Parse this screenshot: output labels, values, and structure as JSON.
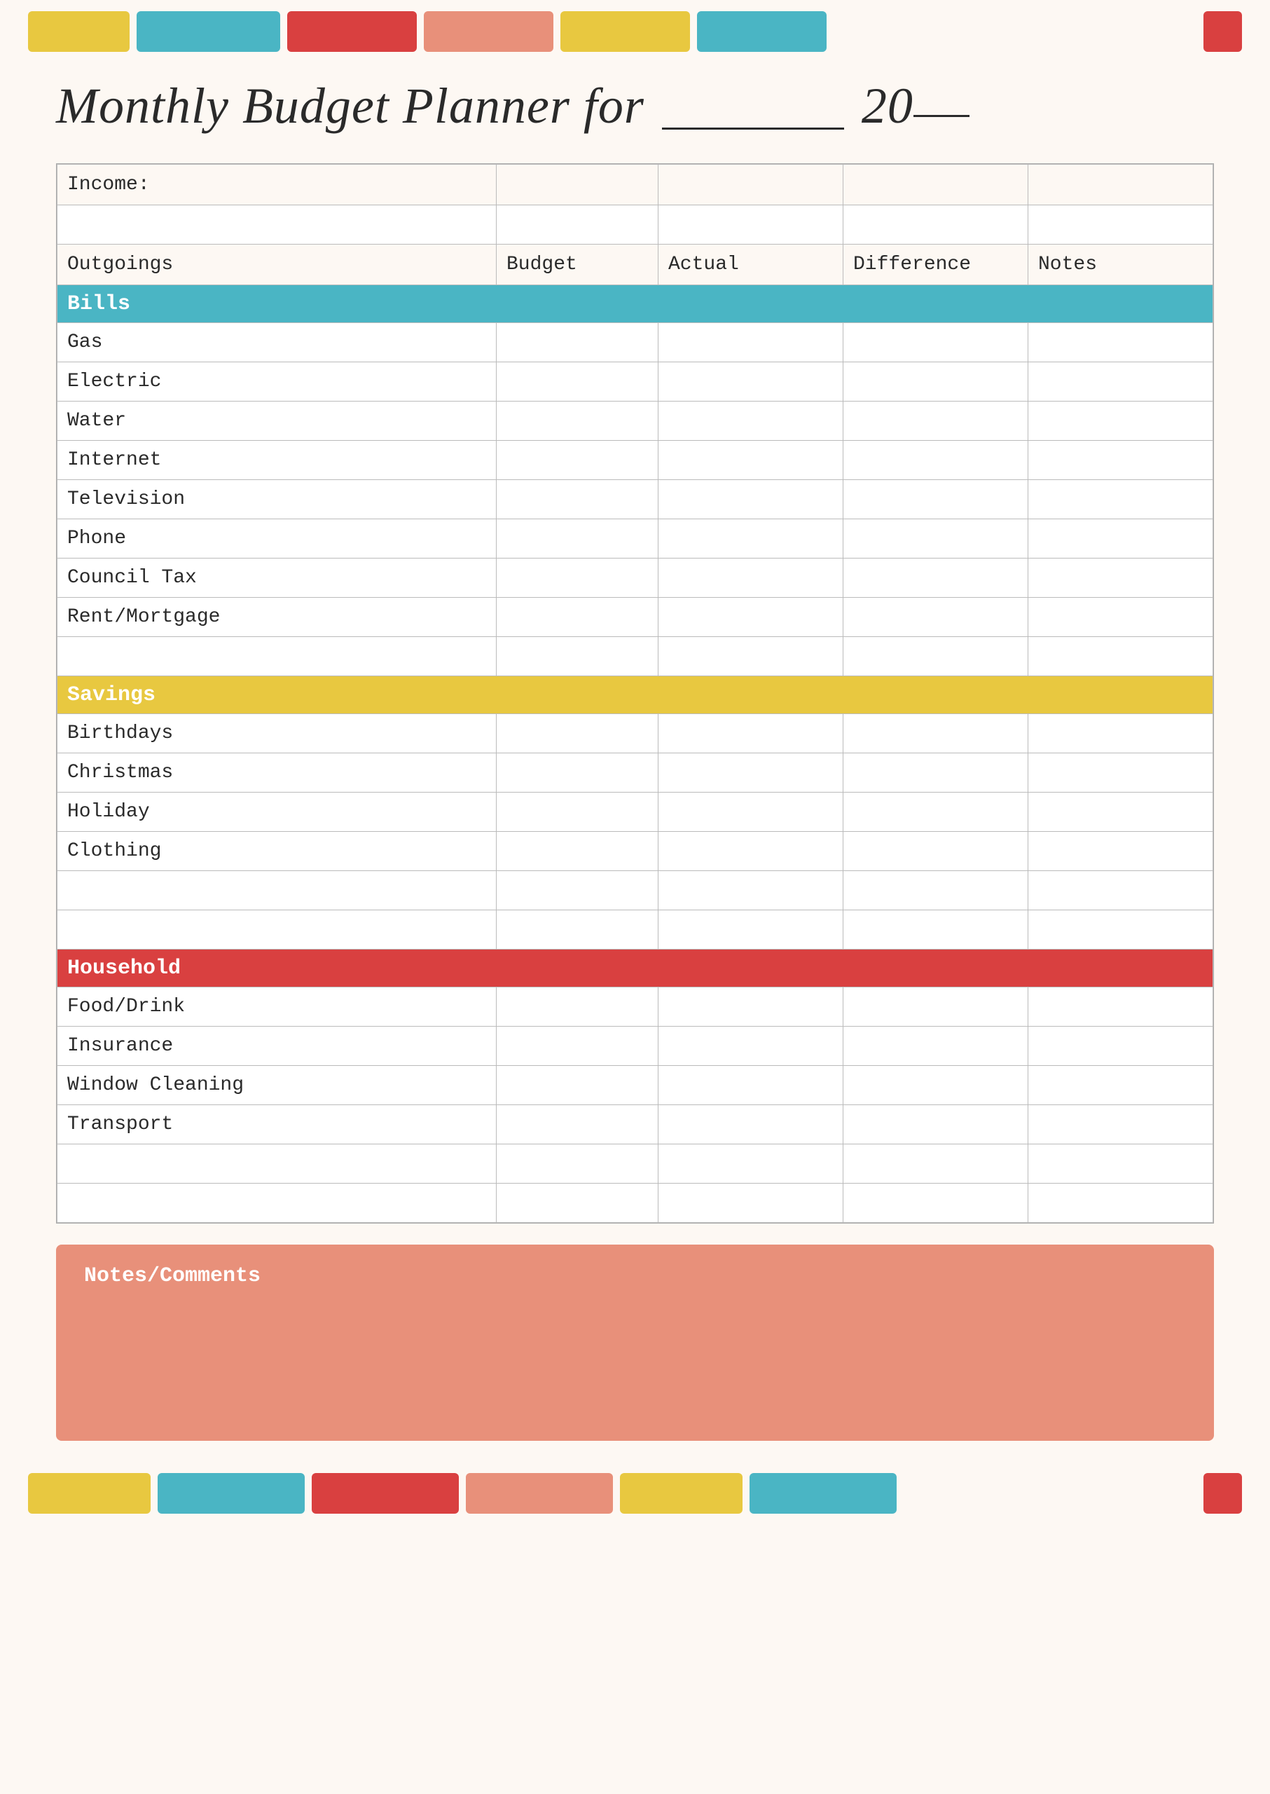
{
  "page": {
    "title": "Monthly Budget Planner for",
    "title_suffix": "20",
    "title_underline_text": "___________",
    "title_year_blank": "__"
  },
  "deco_bars_top": [
    {
      "color": "yellow",
      "label": "deco-bar-yellow-1"
    },
    {
      "color": "teal",
      "label": "deco-bar-teal-1"
    },
    {
      "color": "red",
      "label": "deco-bar-red-1"
    },
    {
      "color": "salmon",
      "label": "deco-bar-salmon-1"
    },
    {
      "color": "yellow",
      "label": "deco-bar-yellow-2"
    },
    {
      "color": "teal",
      "label": "deco-bar-teal-2"
    },
    {
      "color": "red",
      "label": "deco-bar-red-3"
    }
  ],
  "deco_bars_bottom": [
    {
      "color": "yellow",
      "label": "deco-bar-yellow-b1"
    },
    {
      "color": "teal",
      "label": "deco-bar-teal-b1"
    },
    {
      "color": "red",
      "label": "deco-bar-red-b1"
    },
    {
      "color": "salmon",
      "label": "deco-bar-salmon-b1"
    },
    {
      "color": "yellow",
      "label": "deco-bar-yellow-b2"
    },
    {
      "color": "teal",
      "label": "deco-bar-teal-b2"
    },
    {
      "color": "red",
      "label": "deco-bar-red-b3"
    }
  ],
  "table": {
    "income_label": "Income:",
    "headers": {
      "outgoings": "Outgoings",
      "budget": "Budget",
      "actual": "Actual",
      "difference": "Difference",
      "notes": "Notes"
    },
    "sections": [
      {
        "name": "Bills",
        "color": "teal",
        "items": [
          "Gas",
          "Electric",
          "Water",
          "Internet",
          "Television",
          "Phone",
          "Council Tax",
          "Rent/Mortgage"
        ]
      },
      {
        "name": "Savings",
        "color": "yellow",
        "items": [
          "Birthdays",
          "Christmas",
          "Holiday",
          "Clothing"
        ]
      },
      {
        "name": "Household",
        "color": "red",
        "items": [
          "Food/Drink",
          "Insurance",
          "Window Cleaning",
          "Transport"
        ]
      }
    ]
  },
  "notes_section": {
    "title": "Notes/Comments"
  }
}
